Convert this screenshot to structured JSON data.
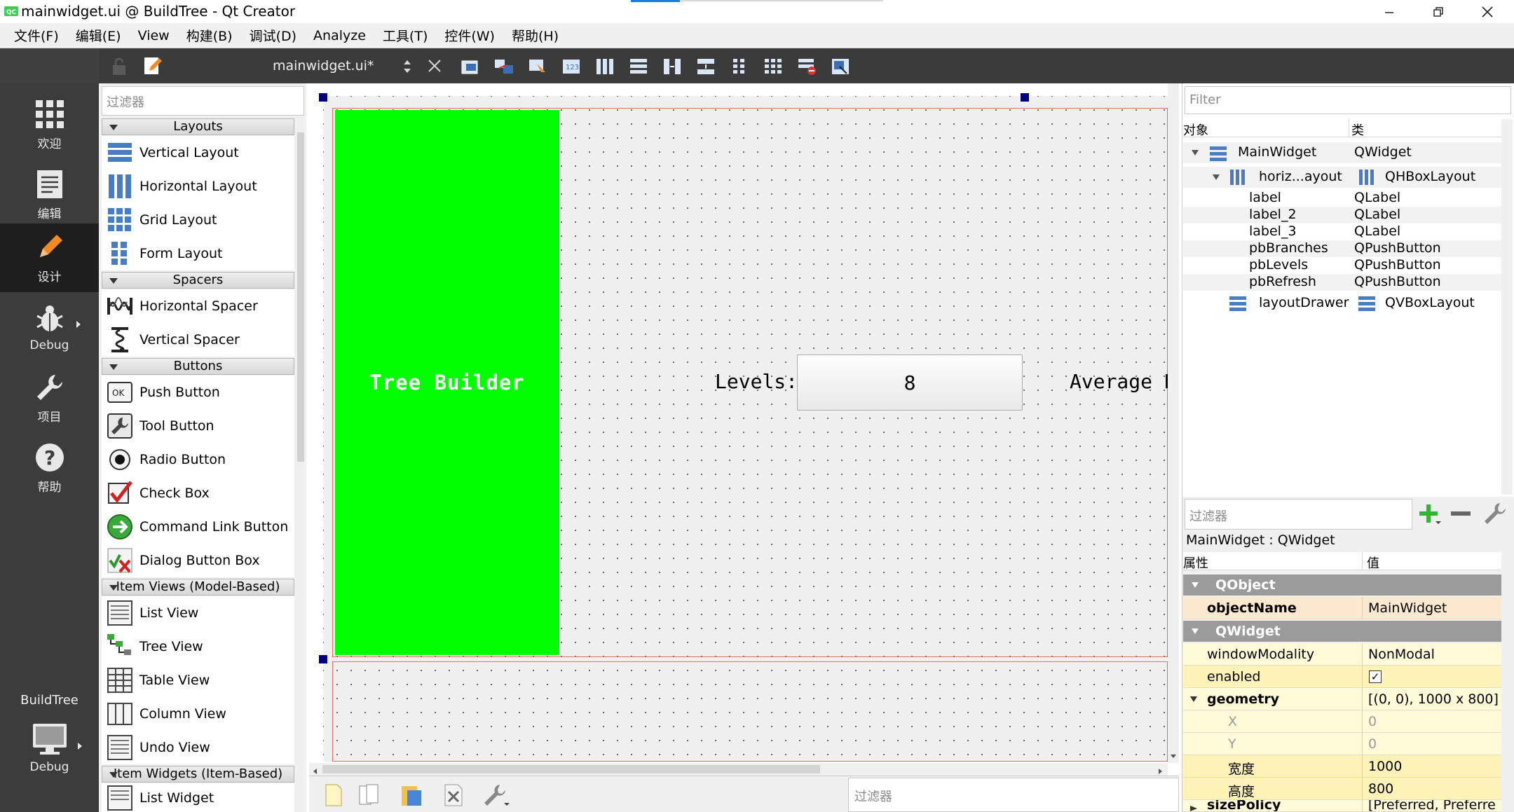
{
  "window": {
    "title": "mainwidget.ui @ BuildTree - Qt Creator"
  },
  "menubar": {
    "items": [
      "文件(F)",
      "编辑(E)",
      "View",
      "构建(B)",
      "调试(D)",
      "Analyze",
      "工具(T)",
      "控件(W)",
      "帮助(H)"
    ]
  },
  "modes": {
    "welcome": "欢迎",
    "edit": "编辑",
    "design": "设计",
    "debug": "Debug",
    "projects": "项目",
    "help": "帮助",
    "target_project": "BuildTree",
    "target_config": "Debug"
  },
  "editor": {
    "filename": "mainwidget.ui*"
  },
  "widgetbox": {
    "filter_placeholder": "过滤器",
    "categories": [
      {
        "name": "Layouts",
        "items": [
          "Vertical Layout",
          "Horizontal Layout",
          "Grid Layout",
          "Form Layout"
        ]
      },
      {
        "name": "Spacers",
        "items": [
          "Horizontal Spacer",
          "Vertical Spacer"
        ]
      },
      {
        "name": "Buttons",
        "items": [
          "Push Button",
          "Tool Button",
          "Radio Button",
          "Check Box",
          "Command Link Button",
          "Dialog Button Box"
        ]
      },
      {
        "name": "Item Views (Model-Based)",
        "items": [
          "List View",
          "Tree View",
          "Table View",
          "Column View",
          "Undo View"
        ]
      },
      {
        "name": "Item Widgets (Item-Based)",
        "items": [
          "List Widget"
        ]
      }
    ]
  },
  "form": {
    "title_label": "Tree Builder",
    "levels_label": "Levels:",
    "levels_button": "8",
    "average_label": "Average B",
    "accent_green": "#00ff00"
  },
  "actionbar": {
    "filter_placeholder": "过滤器"
  },
  "object_inspector": {
    "filter_placeholder": "Filter",
    "col_object": "对象",
    "col_class": "类",
    "rows": [
      {
        "name": "MainWidget",
        "class": "QWidget"
      },
      {
        "name": "horiz...ayout",
        "class": "QHBoxLayout"
      },
      {
        "name": "label",
        "class": "QLabel"
      },
      {
        "name": "label_2",
        "class": "QLabel"
      },
      {
        "name": "label_3",
        "class": "QLabel"
      },
      {
        "name": "pbBranches",
        "class": "QPushButton"
      },
      {
        "name": "pbLevels",
        "class": "QPushButton"
      },
      {
        "name": "pbRefresh",
        "class": "QPushButton"
      },
      {
        "name": "layoutDrawer",
        "class": "QVBoxLayout"
      }
    ]
  },
  "property_editor": {
    "filter_placeholder": "过滤器",
    "title": "MainWidget : QWidget",
    "col_property": "属性",
    "col_value": "值",
    "groups": {
      "qobject": "QObject",
      "qwidget": "QWidget"
    },
    "rows": {
      "objectName": {
        "name": "objectName",
        "value": "MainWidget"
      },
      "windowModality": {
        "name": "windowModality",
        "value": "NonModal"
      },
      "enabled": {
        "name": "enabled",
        "value": "✓"
      },
      "geometry": {
        "name": "geometry",
        "value": "[(0, 0), 1000 x 800]"
      },
      "x": {
        "name": "X",
        "value": "0"
      },
      "y": {
        "name": "Y",
        "value": "0"
      },
      "width": {
        "name": "宽度",
        "value": "1000"
      },
      "height": {
        "name": "高度",
        "value": "800"
      },
      "sizePolicy": {
        "name": "sizePolicy",
        "value": "[Preferred, Preferre"
      }
    }
  }
}
